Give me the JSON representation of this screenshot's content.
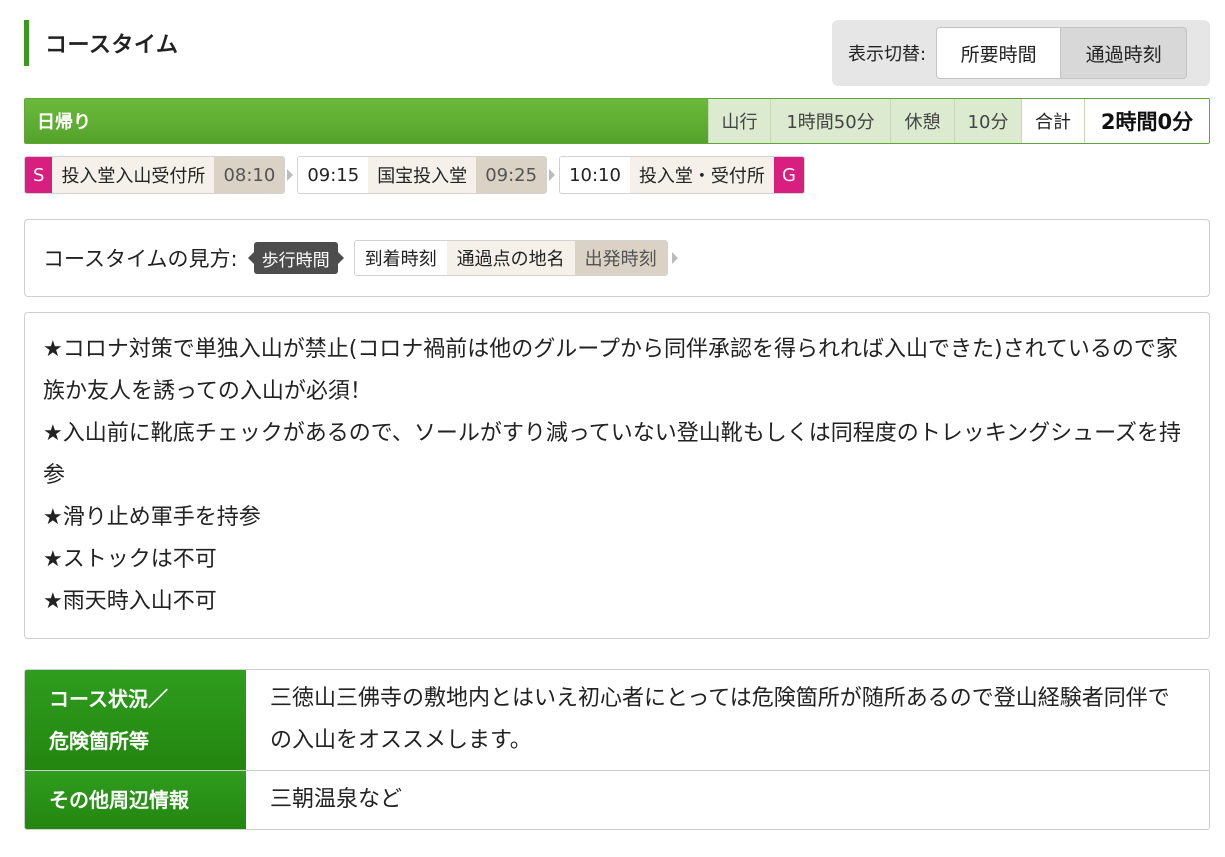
{
  "header": {
    "title": "コースタイム"
  },
  "toggle": {
    "label": "表示切替:",
    "option_a": "所要時間",
    "option_b": "通過時刻"
  },
  "summary": {
    "name": "日帰り",
    "climb_label": "山行",
    "climb_value": "1時間50分",
    "rest_label": "休憩",
    "rest_value": "10分",
    "total_label": "合計",
    "total_value": "2時間0分"
  },
  "route": {
    "start_mark": "S",
    "start_place": "投入堂入山受付所",
    "start_dep": "08:10",
    "mid_arr": "09:15",
    "mid_place": "国宝投入堂",
    "mid_dep": "09:25",
    "end_arr": "10:10",
    "end_place": "投入堂・受付所",
    "end_mark": "G"
  },
  "legend": {
    "label": "コースタイムの見方:",
    "walk": "歩行時間",
    "arrival": "到着時刻",
    "place": "通過点の地名",
    "departure": "出発時刻"
  },
  "notes": [
    "★コロナ対策で単独入山が禁止(コロナ禍前は他のグループから同伴承認を得られれば入山できた)されているので家族か友人を誘っての入山が必須！",
    "★入山前に靴底チェックがあるので、ソールがすり減っていない登山靴もしくは同程度のトレッキングシューズを持参",
    "★滑り止め軍手を持参",
    "★ストックは不可",
    "★雨天時入山不可"
  ],
  "info": {
    "course_label_1": "コース状況／",
    "course_label_2": "危険箇所等",
    "course_text": "三徳山三佛寺の敷地内とはいえ初心者にとっては危険箇所が随所あるので登山経験者同伴での入山をオススメします。",
    "other_label": "その他周辺情報",
    "other_text": "三朝温泉など"
  }
}
